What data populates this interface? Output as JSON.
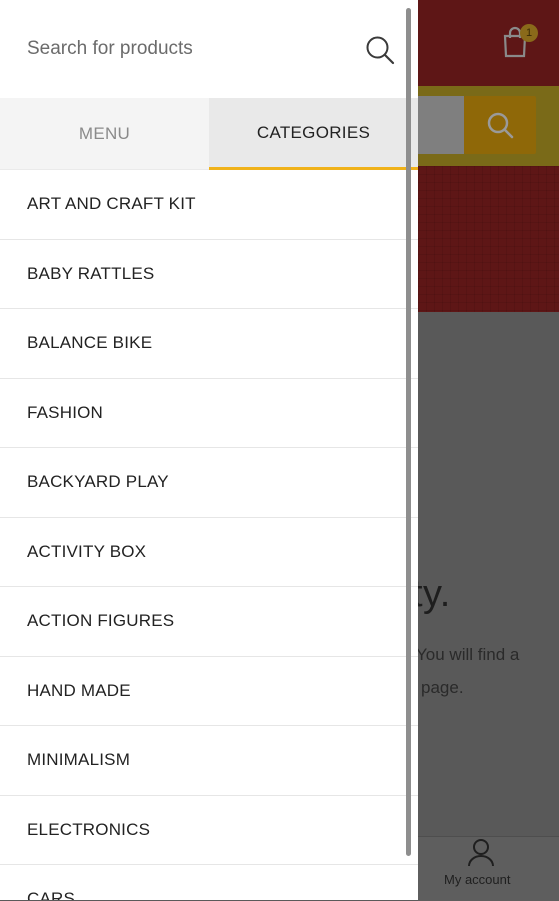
{
  "drawer": {
    "search": {
      "placeholder": "Search for products"
    },
    "tabs": [
      {
        "label": "MENU",
        "active": false
      },
      {
        "label": "CATEGORIES",
        "active": true
      }
    ],
    "categories": [
      "ART AND CRAFT KIT",
      "BABY RATTLES",
      "BALANCE BIKE",
      "FASHION",
      "BACKYARD PLAY",
      "ACTIVITY BOX",
      "ACTION FIGURES",
      "HAND MADE",
      "MINIMALISM",
      "ELECTRONICS",
      "CARS"
    ]
  },
  "background": {
    "cart_badge": "1",
    "heading_fragment": "ty.",
    "text_line1": "You will find a",
    "text_line2": "page.",
    "footer": {
      "account_label": "My account"
    }
  },
  "colors": {
    "accent": "#f0b21a",
    "header_dimmed": "#5e1616",
    "overlay": "#5a5a5a"
  },
  "icons": {
    "search": "search-icon",
    "cart": "shopping-bag-icon",
    "account": "user-icon"
  }
}
